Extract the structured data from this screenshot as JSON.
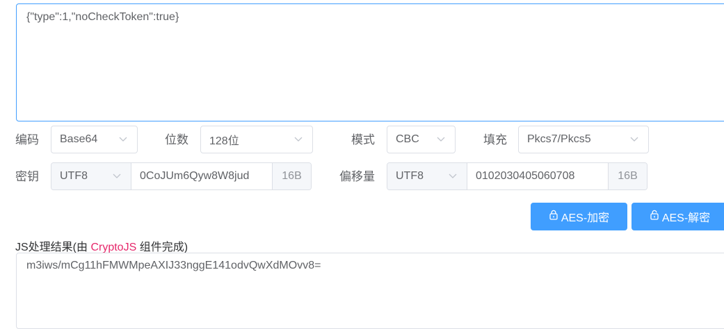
{
  "input": {
    "text": "{\"type\":1,\"noCheckToken\":true}"
  },
  "row1": {
    "encoding_label": "编码",
    "encoding_value": "Base64",
    "bits_label": "位数",
    "bits_value": "128位",
    "mode_label": "模式",
    "mode_value": "CBC",
    "padding_label": "填充",
    "padding_value": "Pkcs7/Pkcs5"
  },
  "row2": {
    "key_label": "密钥",
    "key_encoding": "UTF8",
    "key_value": "0CoJUm6Qyw8W8jud",
    "key_size": "16B",
    "iv_label": "偏移量",
    "iv_encoding": "UTF8",
    "iv_value": "0102030405060708",
    "iv_size": "16B"
  },
  "buttons": {
    "encrypt_label": "AES-加密",
    "decrypt_label": "AES-解密"
  },
  "result": {
    "title_prefix": "JS处理结果(由 ",
    "title_highlight": "CryptoJS",
    "title_suffix": " 组件完成)",
    "output": "m3iws/mCg11hFMWMpeAXIJ33nggE141odvQwXdMOvv8="
  },
  "colors": {
    "primary": "#409eff",
    "highlight": "#e6286b",
    "border": "#dcdfe6"
  }
}
